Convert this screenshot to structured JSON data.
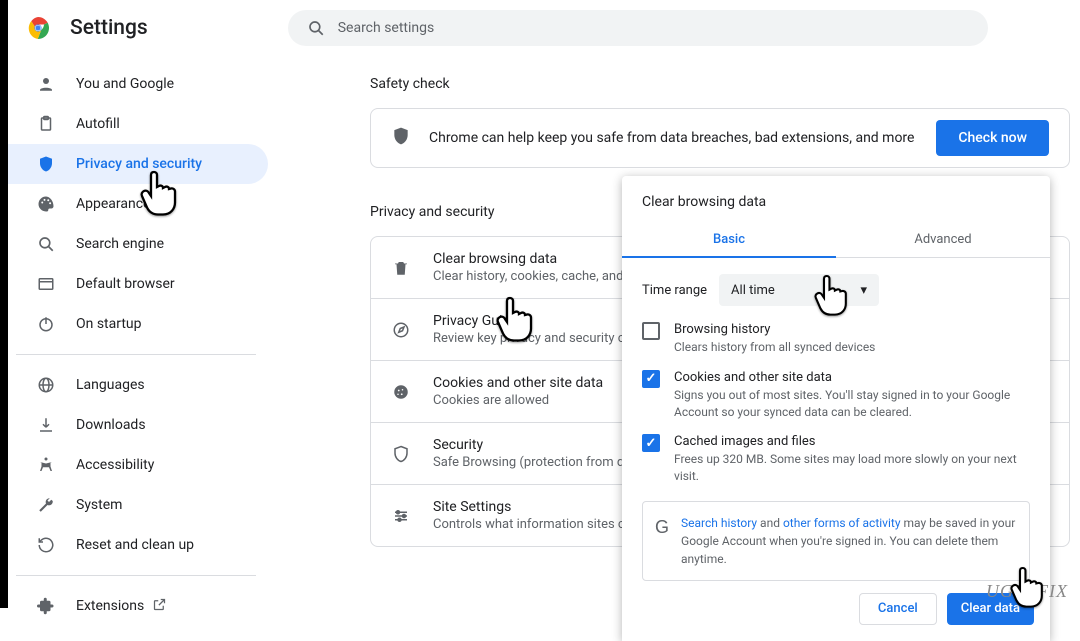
{
  "header": {
    "title": "Settings",
    "search_placeholder": "Search settings"
  },
  "sidebar": {
    "items": [
      {
        "label": "You and Google"
      },
      {
        "label": "Autofill"
      },
      {
        "label": "Privacy and security"
      },
      {
        "label": "Appearance"
      },
      {
        "label": "Search engine"
      },
      {
        "label": "Default browser"
      },
      {
        "label": "On startup"
      }
    ],
    "group2": [
      {
        "label": "Languages"
      },
      {
        "label": "Downloads"
      },
      {
        "label": "Accessibility"
      },
      {
        "label": "System"
      },
      {
        "label": "Reset and clean up"
      }
    ],
    "extensions": "Extensions"
  },
  "safety": {
    "heading": "Safety check",
    "text": "Chrome can help keep you safe from data breaches, bad extensions, and more",
    "button": "Check now"
  },
  "privacy": {
    "heading": "Privacy and security",
    "rows": [
      {
        "title": "Clear browsing data",
        "sub": "Clear history, cookies, cache, and more"
      },
      {
        "title": "Privacy Guide",
        "sub": "Review key privacy and security controls"
      },
      {
        "title": "Cookies and other site data",
        "sub": "Cookies are allowed"
      },
      {
        "title": "Security",
        "sub": "Safe Browsing (protection from dangerous sites) and other security settings"
      },
      {
        "title": "Site Settings",
        "sub": "Controls what information sites can use and show"
      }
    ]
  },
  "dialog": {
    "title": "Clear browsing data",
    "tab_basic": "Basic",
    "tab_adv": "Advanced",
    "time_label": "Time range",
    "time_value": "All time",
    "options": [
      {
        "title": "Browsing history",
        "sub": "Clears history from all synced devices",
        "checked": false
      },
      {
        "title": "Cookies and other site data",
        "sub": "Signs you out of most sites. You'll stay signed in to your Google Account so your synced data can be cleared.",
        "checked": true
      },
      {
        "title": "Cached images and files",
        "sub": "Frees up 320 MB. Some sites may load more slowly on your next visit.",
        "checked": true
      }
    ],
    "info_link1": "Search history",
    "info_mid": " and ",
    "info_link2": "other forms of activity",
    "info_rest": " may be saved in your Google Account when you're signed in. You can delete them anytime.",
    "cancel": "Cancel",
    "clear": "Clear data"
  },
  "watermark": "UGETFIX"
}
